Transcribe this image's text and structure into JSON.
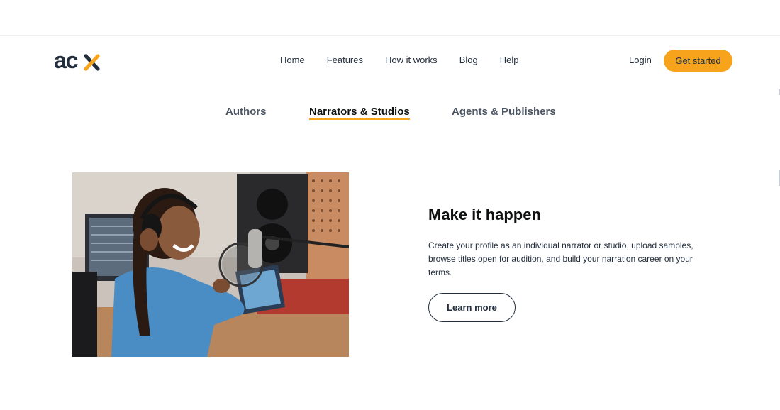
{
  "brand": {
    "logo_text": "acx",
    "accent": "#f7a41c",
    "text_color": "#232f3e"
  },
  "nav": {
    "items": [
      "Home",
      "Features",
      "How it works",
      "Blog",
      "Help"
    ]
  },
  "header": {
    "login": "Login",
    "get_started": "Get started"
  },
  "tabs": {
    "authors": "Authors",
    "narrators": "Narrators & Studios",
    "agents": "Agents & Publishers",
    "active": "Narrators & Studios"
  },
  "hero": {
    "title": "Make it happen",
    "description": "Create your profile as an individual narrator or studio, upload samples, browse titles open for audition, and build your narration career on your terms.",
    "button": "Learn more"
  }
}
